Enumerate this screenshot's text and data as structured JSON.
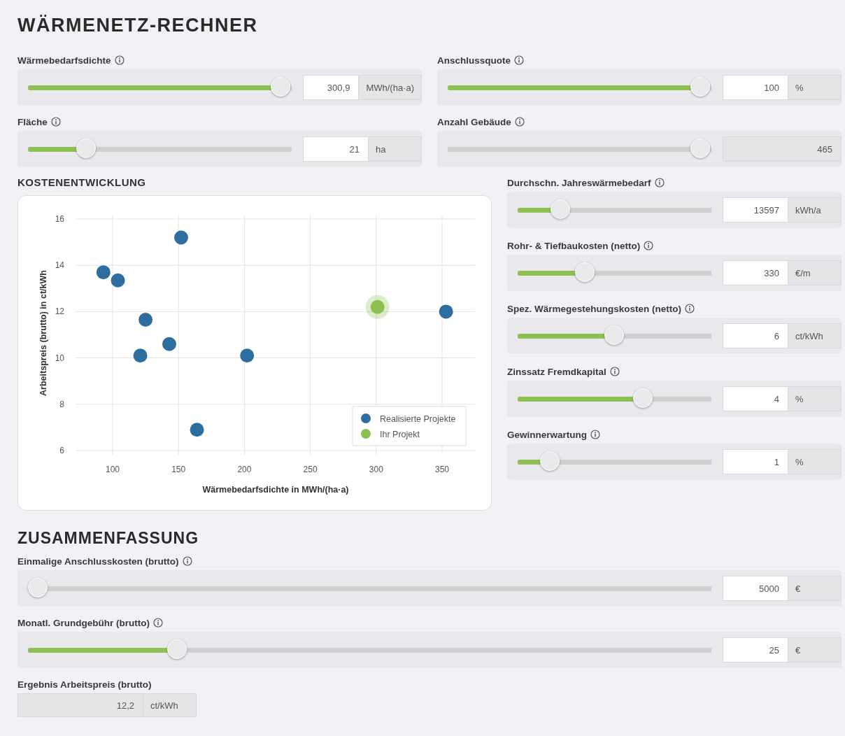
{
  "title": "WÄRMENETZ-RECHNER",
  "top_sliders": [
    {
      "label": "Wärmebedarfsdichte",
      "info": true,
      "level": 1.0,
      "value": "300,9",
      "unit": "MWh/(ha·a)",
      "disabled": false
    },
    {
      "label": "Anschlussquote",
      "info": true,
      "level": 1.0,
      "value": "100",
      "unit": "%",
      "disabled": false
    },
    {
      "label": "Fläche",
      "info": true,
      "level": 0.2,
      "value": "21",
      "unit": "ha",
      "disabled": false
    },
    {
      "label": "Anzahl Gebäude",
      "info": true,
      "level": 1.0,
      "value": "465",
      "disabled": true
    }
  ],
  "cost_section": {
    "heading": "KOSTENENTWICKLUNG",
    "chart_data": {
      "type": "scatter",
      "grid": true,
      "legend": true,
      "xlabel": "Wärmebedarfsdichte in MWh/(ha·a)",
      "ylabel": "Arbeitspreis (brutto) in ct/kWh",
      "xlim": [
        72,
        375
      ],
      "ylim": [
        6,
        16
      ],
      "xticks": [
        100,
        150,
        200,
        250,
        300,
        350
      ],
      "yticks": [
        6,
        8,
        10,
        12,
        14,
        16
      ],
      "series": [
        {
          "name": "Realisierte Projekte",
          "color": "#2e6e9e",
          "x": [
            93,
            104,
            152,
            125,
            143,
            121,
            202,
            164,
            353
          ],
          "values": [
            13.7,
            13.35,
            15.2,
            11.65,
            10.6,
            10.1,
            10.1,
            6.9,
            12.0
          ]
        },
        {
          "name": "Ihr Projekt",
          "color": "#8cc152",
          "x": [
            301
          ],
          "values": [
            12.2
          ]
        }
      ]
    },
    "sliders": [
      {
        "label": "Durchschn. Jahreswärmebedarf",
        "info": true,
        "level": 0.19,
        "value": "13597",
        "unit": "kWh/a",
        "disabled": false
      },
      {
        "label": "Rohr- & Tiefbaukosten (netto)",
        "info": true,
        "level": 0.33,
        "value": "330",
        "unit": "€/m",
        "disabled": false
      },
      {
        "label": "Spez. Wärmegestehungskosten (netto)",
        "info": true,
        "level": 0.5,
        "value": "6",
        "unit": "ct/kWh",
        "disabled": false
      },
      {
        "label": "Zinssatz Fremdkapital",
        "info": true,
        "level": 0.67,
        "value": "4",
        "unit": "%",
        "disabled": false
      },
      {
        "label": "Gewinnerwartung",
        "info": true,
        "level": 0.13,
        "value": "1",
        "unit": "%",
        "disabled": false
      }
    ]
  },
  "summary": {
    "heading": "ZUSAMMENFASSUNG",
    "sliders": [
      {
        "label": "Einmalige Anschlusskosten (brutto)",
        "info": true,
        "level": 0.0,
        "value": "5000",
        "unit": "€",
        "disabled": false
      },
      {
        "label": "Monatl. Grundgebühr (brutto)",
        "info": true,
        "level": 0.21,
        "value": "25",
        "unit": "€",
        "disabled": false
      }
    ],
    "result": {
      "label": "Ergebnis Arbeitspreis (brutto)",
      "value": "12,2",
      "unit": "ct/kWh"
    }
  }
}
